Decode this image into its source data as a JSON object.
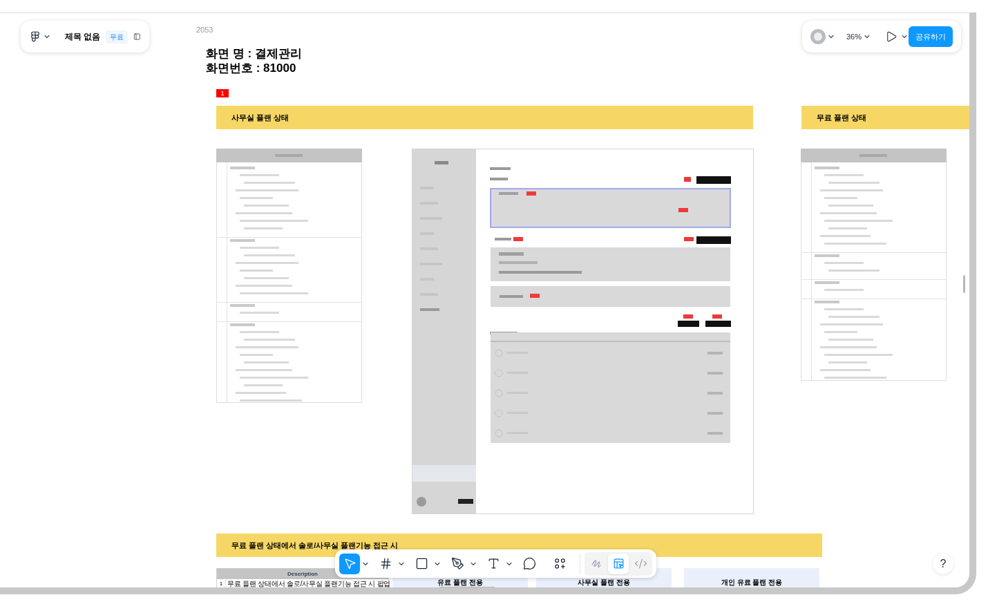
{
  "file": {
    "title": "제목 없음",
    "plan_badge": "무료"
  },
  "top_right": {
    "zoom": "36%",
    "share_button": "공유하기"
  },
  "canvas": {
    "frame_label": "2053",
    "heading_lines": [
      "화면 명 : 결제관리",
      "화면번호 : 81000"
    ],
    "marker": "1",
    "sections": [
      {
        "title": "사무실 플랜 상태"
      },
      {
        "title": "무료 플랜 상태"
      },
      {
        "title": "무료 플랜 상태에서 솔로/사무실 플랜기능 접근 시"
      }
    ],
    "popup_table": {
      "header": "Description",
      "rows": [
        {
          "number": "1",
          "text": "무료 플랜 상태에서 솔로/사무실 플랜기능 접근 시 팝업"
        }
      ]
    },
    "plan_cards": [
      {
        "label": "유료 플랜 전용"
      },
      {
        "label": "사무실 플랜 전용"
      },
      {
        "label": "개인 유료 플랜 전용"
      }
    ]
  },
  "toolbar": {
    "tools": [
      {
        "kind": "move",
        "selected": true,
        "has_menu": true
      },
      {
        "kind": "frame",
        "selected": false,
        "has_menu": true
      },
      {
        "kind": "rectangle",
        "selected": false,
        "has_menu": true
      },
      {
        "kind": "pen",
        "selected": false,
        "has_menu": true
      },
      {
        "kind": "text",
        "selected": false,
        "has_menu": true
      },
      {
        "kind": "comment",
        "selected": false,
        "has_menu": false
      },
      {
        "kind": "assets",
        "selected": false,
        "has_menu": false
      }
    ],
    "modes": [
      {
        "kind": "draw",
        "selected": false
      },
      {
        "kind": "design",
        "selected": true
      },
      {
        "kind": "code",
        "selected": false
      }
    ]
  },
  "help": "?"
}
